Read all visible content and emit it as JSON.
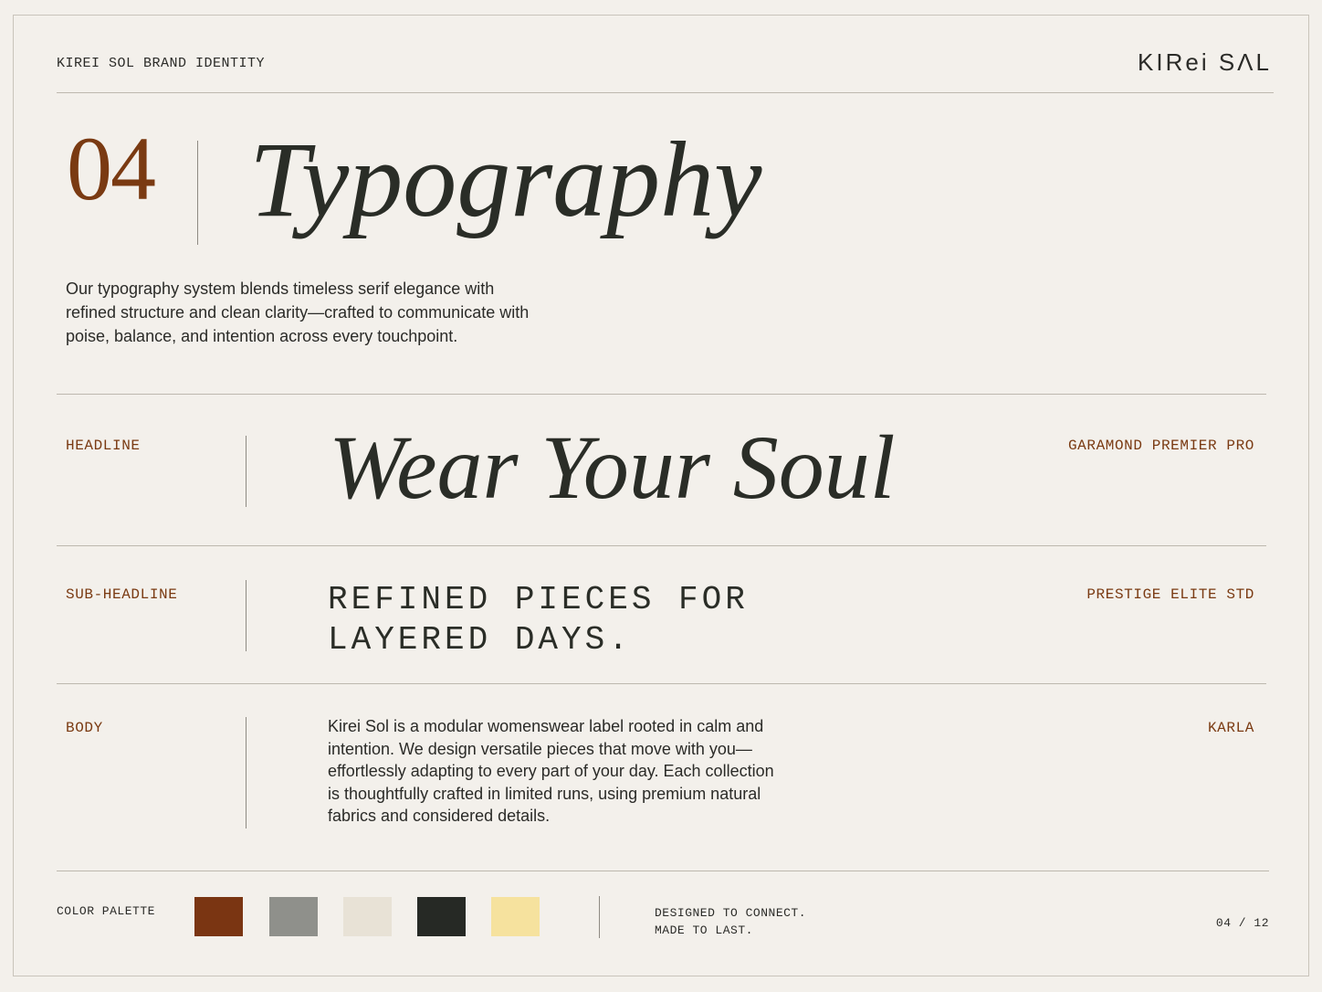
{
  "header": {
    "title": "KIREI SOL BRAND IDENTITY",
    "logo_text": "KIRei SɅL"
  },
  "section": {
    "number": "04",
    "title": "Typography",
    "intro": "Our typography system blends timeless serif elegance with refined structure and clean clarity—crafted to communicate with poise, balance, and intention across every touchpoint."
  },
  "type_specimens": [
    {
      "role": "HEADLINE",
      "sample": "Wear Your Soul",
      "font_name": "GARAMOND PREMIER PRO"
    },
    {
      "role": "SUB-HEADLINE",
      "sample": "REFINED PIECES FOR LAYERED DAYS.",
      "font_name": "PRESTIGE ELITE STD"
    },
    {
      "role": "BODY",
      "sample": "Kirei Sol is a modular womenswear label rooted in calm and intention. We design versatile pieces that move with you—effortlessly adapting to every part of your day. Each collection is thoughtfully crafted in limited runs, using premium natural fabrics and considered details.",
      "font_name": "KARLA"
    }
  ],
  "footer": {
    "palette_label": "COLOR PALETTE",
    "swatches": [
      {
        "name": "rust",
        "color": "#7a3512"
      },
      {
        "name": "stone-gray",
        "color": "#8f908b"
      },
      {
        "name": "cream",
        "color": "#e8e2d6"
      },
      {
        "name": "charcoal",
        "color": "#262925"
      },
      {
        "name": "butter-yellow",
        "color": "#f6e29e"
      }
    ],
    "tagline_line1": "DESIGNED TO CONNECT.",
    "tagline_line2": "MADE TO LAST.",
    "page_indicator": "04 / 12"
  },
  "colors": {
    "background": "#f3f0eb",
    "accent": "#7a3a12",
    "text": "#2a2d27"
  }
}
